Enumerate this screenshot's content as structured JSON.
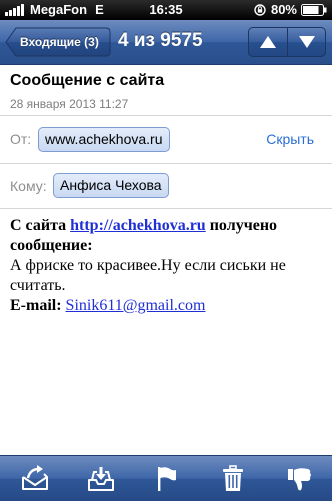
{
  "status_bar": {
    "carrier": "MegaFon",
    "network": "E",
    "time": "16:35",
    "battery": "80%"
  },
  "nav": {
    "back_label": "Входящие (3)",
    "title": "4 из 9575"
  },
  "message": {
    "subject": "Сообщение с сайта",
    "date": "28 января 2013 11:27",
    "from_label": "От:",
    "from_value": "www.achekhova.ru",
    "hide_label": "Скрыть",
    "to_label": "Кому:",
    "to_value": "Анфиса Чехова",
    "body": {
      "intro_prefix": "С сайта ",
      "site_link": "http://achekhova.ru",
      "intro_suffix": " получено сообщение:",
      "text": "А фриске то красивее.Ну если сиськи не считать.",
      "email_label": "E-mail: ",
      "email_link": "Sinik611@gmail.com"
    }
  },
  "toolbar": {
    "icons": [
      "move-folder-icon",
      "inbox-tray-icon",
      "flag-icon",
      "trash-icon",
      "reply-icon"
    ]
  },
  "colors": {
    "nav_blue": "#3e66a8",
    "link_blue": "#2a6fd6",
    "pill_border": "#7d9cd0"
  }
}
